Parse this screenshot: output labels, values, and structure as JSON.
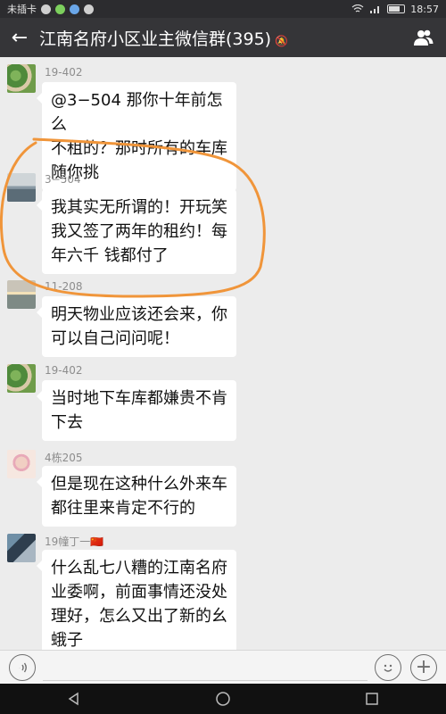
{
  "status_bar": {
    "carrier": "未插卡",
    "time": "18:57",
    "icons": [
      "no-sim-icon",
      "wechat-icon",
      "app-icon",
      "mute-icon",
      "wifi-icon",
      "battery-icon"
    ]
  },
  "header": {
    "title": "江南名府小区业主微信群(395)",
    "mute_icon": "🔕",
    "back_icon": "←",
    "members_icon": "group-icon"
  },
  "messages": [
    {
      "sender": "19-402",
      "text_lines": [
        "@3−504 那你十年前怎么",
        "不租的？那时所有的车库",
        "随你挑"
      ]
    },
    {
      "sender": "3−504",
      "text_lines": [
        "我其实无所谓的！开玩笑",
        "我又签了两年的租约！每",
        "年六千 钱都付了"
      ]
    },
    {
      "sender": "11-208",
      "text_lines": [
        "明天物业应该还会来，你",
        "可以自己问问呢！"
      ]
    },
    {
      "sender": "19-402",
      "text_lines": [
        "当时地下车库都嫌贵不肯",
        "下去"
      ]
    },
    {
      "sender": "4栋205",
      "text_lines": [
        "但是现在这种什么外来车",
        "都往里来肯定不行的"
      ]
    },
    {
      "sender": "19幢丁一🇨🇳",
      "text_lines": [
        "什么乱七八糟的江南名府",
        "业委啊，前面事情还没处",
        "理好，怎么又出了新的幺",
        "蛾子"
      ]
    }
  ],
  "input_bar": {
    "voice_icon": "voice-icon",
    "emoji_icon": "emoji-icon",
    "plus_icon": "plus-icon"
  },
  "nav_bar": {
    "back": "◁",
    "home": "○",
    "recent": "□"
  },
  "colors": {
    "titlebar": "#353538",
    "statusbar": "#2c2c2f",
    "chat_bg": "#ececec",
    "annotation": "#f0953a"
  }
}
